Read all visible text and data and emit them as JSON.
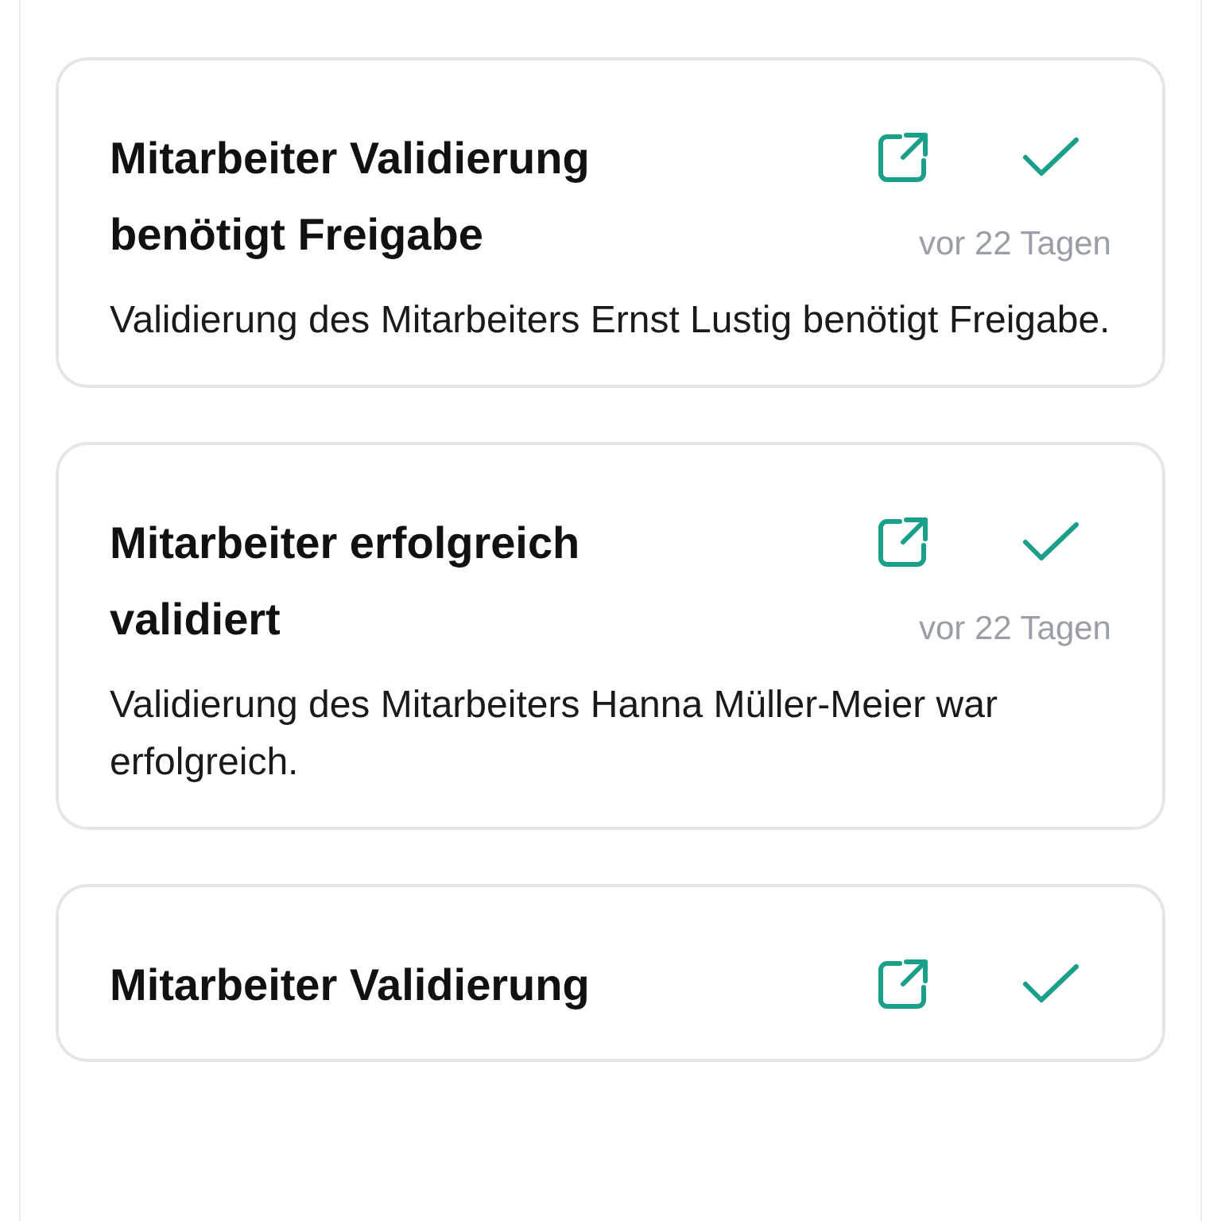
{
  "notifications": [
    {
      "title": "Mitarbeiter Validierung benötigt Freigabe",
      "time": "vor 22 Tagen",
      "body": "Validierung des Mitarbeiters Ernst Lustig benötigt Freigabe."
    },
    {
      "title": "Mitarbeiter erfolgreich validiert",
      "time": "vor 22 Tagen",
      "body": "Validierung des Mitarbeiters Hanna Müller-Meier war erfolgreich."
    },
    {
      "title": "Mitarbeiter Validierung"
    }
  ]
}
